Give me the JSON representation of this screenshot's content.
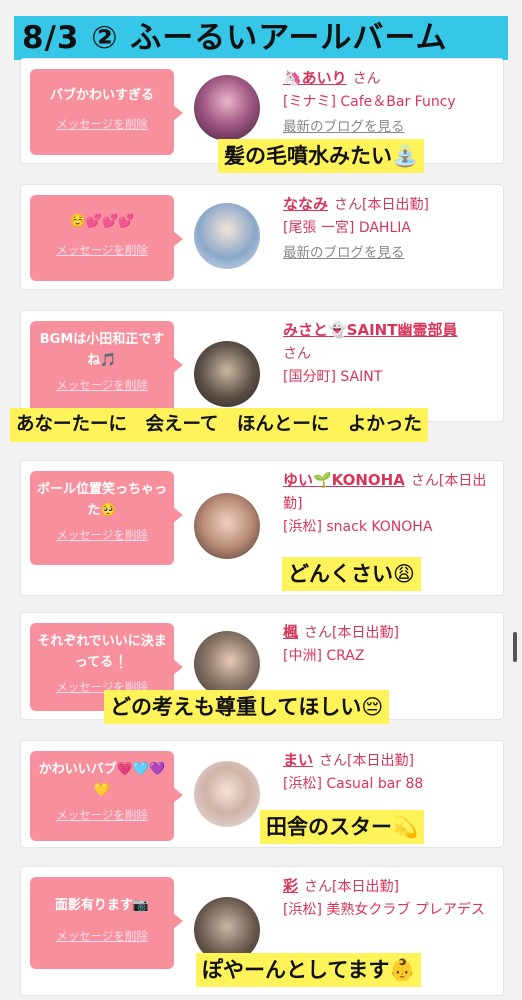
{
  "title": "8/3 ② ふーるいアールバーム",
  "delete_label": "メッセージを削除",
  "blog_label": "最新のブログを見る",
  "san_label": "さん",
  "cards": [
    {
      "message": "バブかわいすぎる",
      "name": "🦄あいり",
      "status": "",
      "shop": "[ミナミ] Cafe＆Bar Funcy",
      "blog": "最新のブログを見る",
      "caption": "髪の毛噴水みたい⛲"
    },
    {
      "message": "☺️💕💕💕",
      "name": "ななみ",
      "status": "[本日出勤]",
      "shop": "[尾張 一宮] DAHLIA",
      "blog": "最新のブログを見る",
      "caption": ""
    },
    {
      "message": "BGMは小田和正ですね🎵",
      "name": "みさと👻SAINT幽霊部員",
      "status": "",
      "shop": "[国分町] SAINT",
      "blog": "",
      "caption": "あなーたーに　会えーて　ほんとーに　よかった"
    },
    {
      "message": "ボール位置笑っちゃった🥺",
      "name": "ゆい🌱KONOHA",
      "status": "[本日出勤]",
      "shop": "[浜松] snack KONOHA",
      "blog": "",
      "caption": "どんくさい😩"
    },
    {
      "message": "それぞれでいいに決まってる❕",
      "name": "楓",
      "status": "[本日出勤]",
      "shop": "[中洲] CRAZ",
      "blog": "",
      "caption": "どの考えも尊重してほしい😔"
    },
    {
      "message": "かわいいバブ💗🩵💜💛",
      "name": "まい",
      "status": "[本日出勤]",
      "shop": "[浜松] Casual bar 88",
      "blog": "",
      "caption": "田舎のスター💫"
    },
    {
      "message": "面影有ります📷",
      "name": "彩",
      "status": "[本日出勤]",
      "shop": "[浜松] 美熟女クラブ プレアデス",
      "blog": "",
      "caption": "ぽやーんとしてます👶"
    }
  ],
  "colors": {
    "title_bg": "#35c6e8",
    "message_bg": "#f7909c",
    "caption_bg": "#fff35a",
    "accent": "#d9345a"
  }
}
